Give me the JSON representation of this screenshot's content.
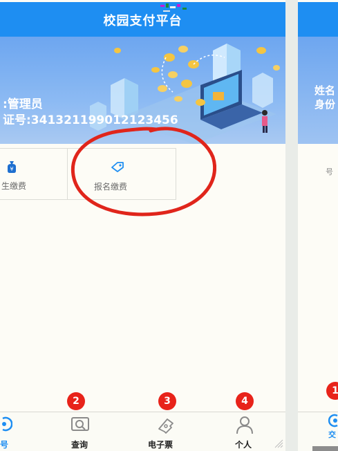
{
  "app": {
    "title": "校园支付平台"
  },
  "profile": {
    "name_line": ":管理员",
    "id_line": "证号:341321199012123456"
  },
  "tiles": [
    {
      "label": "生缴费",
      "icon": "money-bag-icon"
    },
    {
      "label": "报名缴费",
      "icon": "tag-icon"
    }
  ],
  "nav": {
    "items": [
      {
        "label": "号",
        "icon": "home-icon"
      },
      {
        "label": "查询",
        "icon": "search-screen-icon",
        "badge": "2"
      },
      {
        "label": "电子票",
        "icon": "ticket-icon",
        "badge": "3"
      },
      {
        "label": "个人",
        "icon": "person-icon",
        "badge": "4"
      }
    ]
  },
  "right_panel": {
    "name_line": "姓名",
    "id_line": "身份",
    "tile_label": "号",
    "nav_label": "交",
    "badge": "1"
  },
  "colors": {
    "primary": "#1e8ef2",
    "badge": "#e8231a",
    "annotation": "#e0251b",
    "background": "#fdfcf6"
  }
}
